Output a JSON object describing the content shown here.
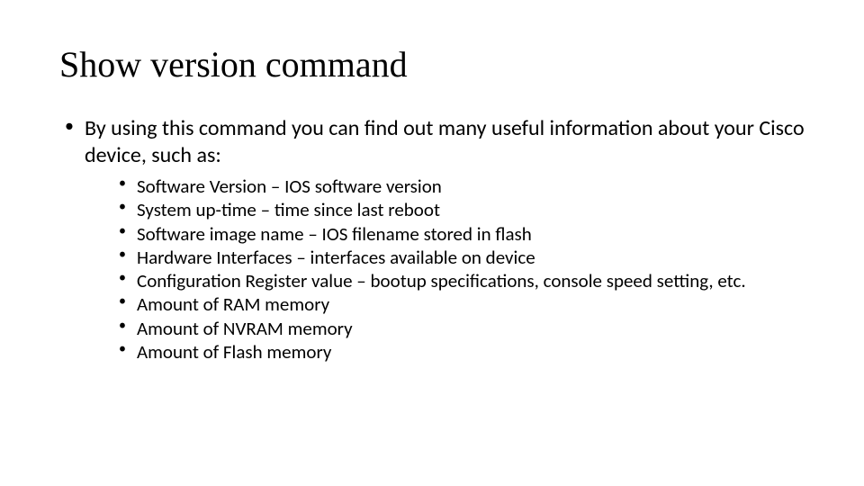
{
  "slide": {
    "title": "Show version command",
    "bullets": [
      {
        "text": "By using this command you can find out many useful information about your Cisco device, such as:",
        "sub": [
          "Software Version – IOS software version",
          "System up-time – time since last reboot",
          "Software image name – IOS filename stored in flash",
          "Hardware Interfaces – interfaces available on device",
          "Configuration Register value – bootup specifications, console speed setting, etc.",
          "Amount of RAM memory",
          "Amount of NVRAM memory",
          "Amount of Flash memory"
        ]
      }
    ]
  }
}
